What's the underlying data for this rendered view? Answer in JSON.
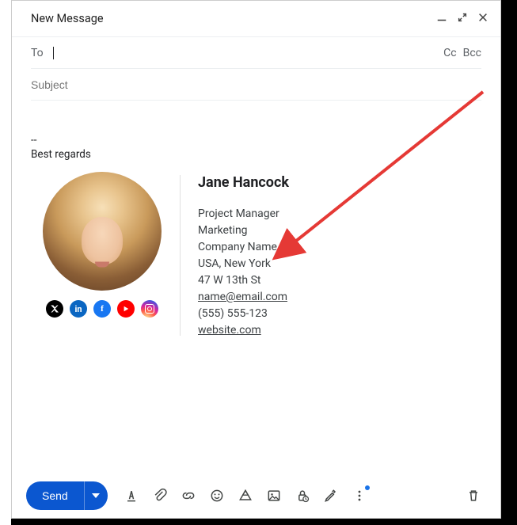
{
  "header": {
    "title": "New Message"
  },
  "fields": {
    "to_label": "To",
    "cc_label": "Cc",
    "bcc_label": "Bcc",
    "subject_placeholder": "Subject"
  },
  "body": {
    "separator": "--",
    "regards": "Best regards"
  },
  "signature": {
    "name": "Jane Hancock",
    "title": "Project Manager",
    "department": "Marketing",
    "company": "Company Name",
    "location": "USA, New York",
    "street": "47 W 13th St",
    "email": "name@email.com",
    "phone": "(555) 555-123",
    "website": "website.com",
    "socials": {
      "x": "X",
      "linkedin": "in",
      "facebook": "f",
      "youtube": "▶",
      "instagram": ""
    }
  },
  "toolbar": {
    "send_label": "Send"
  }
}
